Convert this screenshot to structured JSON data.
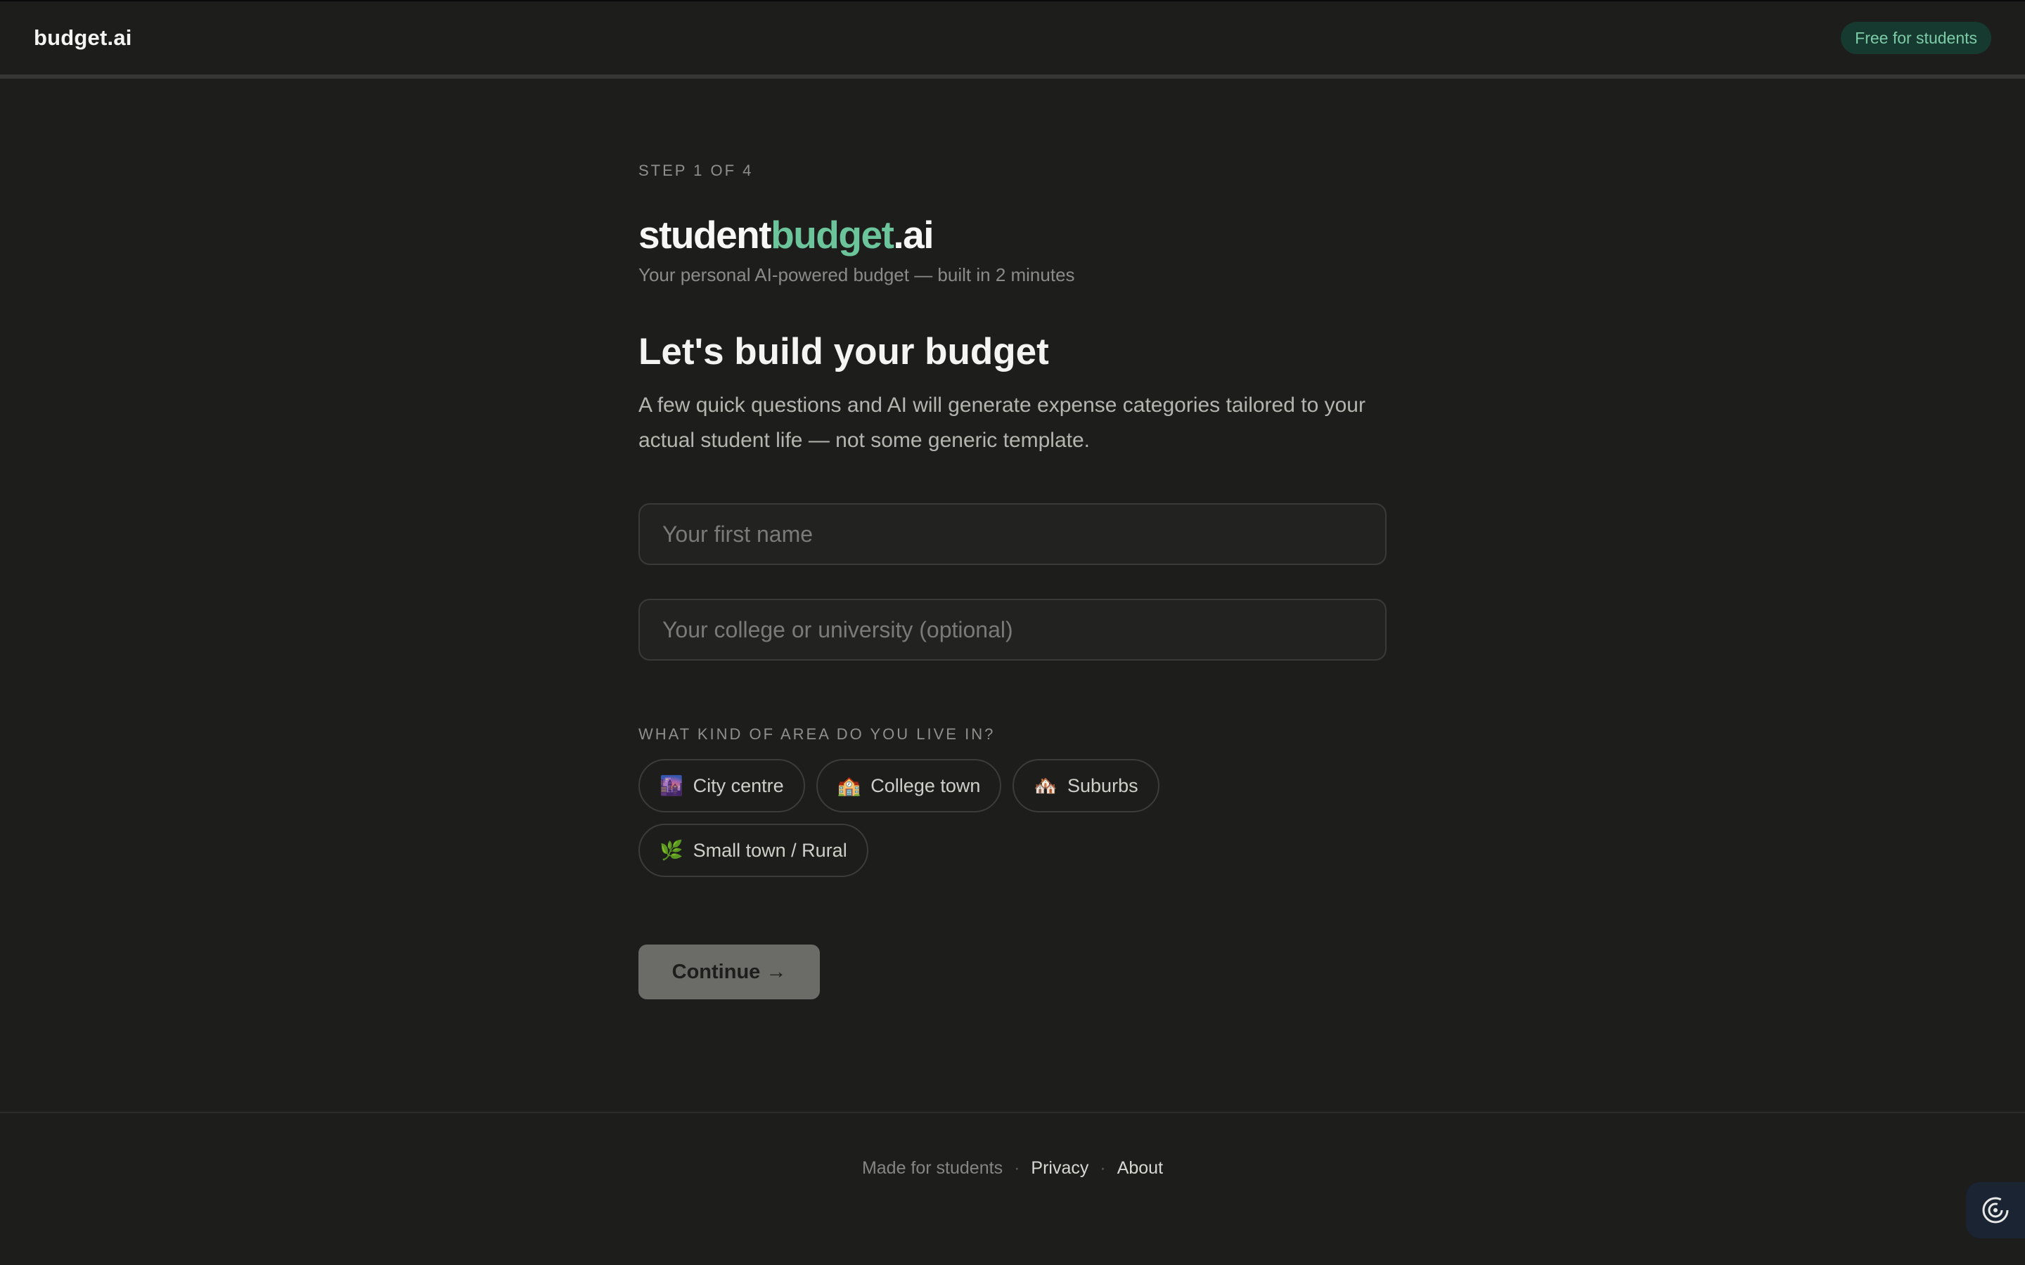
{
  "header": {
    "brand": "budget.ai",
    "badge": "Free for students"
  },
  "onboarding": {
    "step": "STEP 1 OF 4",
    "logo": {
      "part1": "student",
      "part2": "budget",
      "part3": ".ai"
    },
    "tagline": "Your personal AI-powered budget — built in 2 minutes",
    "heading": "Let's build your budget",
    "intro": "A few quick questions and AI will generate expense categories tailored to your actual student life — not some generic template.",
    "fields": {
      "first_name_placeholder": "Your first name",
      "college_placeholder": "Your college or university (optional)"
    },
    "area_label": "WHAT KIND OF AREA DO YOU LIVE IN?",
    "area_options": [
      {
        "icon": "cityscape-icon",
        "emoji": "🌆",
        "label": "City centre"
      },
      {
        "icon": "school-icon",
        "emoji": "🏫",
        "label": "College town"
      },
      {
        "icon": "houses-icon",
        "emoji": "🏘️",
        "label": "Suburbs"
      },
      {
        "icon": "herb-icon",
        "emoji": "🌿",
        "label": "Small town / Rural"
      }
    ],
    "continue_label": "Continue →"
  },
  "footer": {
    "made_for": "Made for students",
    "separator": "·",
    "privacy": "Privacy",
    "about": "About"
  },
  "colors": {
    "background": "#1d1d1c",
    "accent": "#6cc49b",
    "badge_bg": "#163a2f"
  }
}
